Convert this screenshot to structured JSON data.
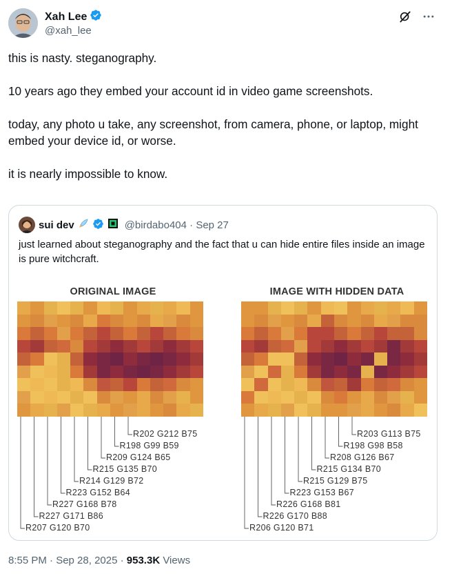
{
  "author": {
    "name": "Xah Lee",
    "handle": "@xah_lee"
  },
  "tweet": {
    "paragraphs": [
      "this is nasty. steganography.",
      "10 years ago they embed your account id in video game screenshots.",
      "today, any photo u take, any screenshot, from camera, phone, or laptop, might embed your device id, or worse.",
      "it is nearly impossible to know."
    ]
  },
  "quote": {
    "name": "sui dev",
    "handle": "@birdabo404",
    "date": "Sep 27",
    "text": "just learned about steganography and the fact that u can hide entire files inside an image is pure witchcraft.",
    "image": {
      "left_title": "ORIGINAL IMAGE",
      "right_title": "IMAGE WITH HIDDEN DATA",
      "left_values": [
        "R202 G212 B75",
        "R198 G99 B59",
        "R209 G124 B65",
        "R215 G135 B70",
        "R214 G129 B72",
        "R223 G152 B64",
        "R227 G168 B78",
        "R227 G171 B86",
        "R207 G120 B70"
      ],
      "right_values": [
        "R203 G113 B75",
        "R198 G98 B58",
        "R208 G126 B67",
        "R215 G134 B70",
        "R215 G129 B75",
        "R223 G153 B67",
        "R226 G168 B81",
        "R226 G170 B88",
        "R206 G120 B71"
      ]
    }
  },
  "footer": {
    "time": "8:55 PM · Sep 28, 2025 · ",
    "views_count": "953.3K",
    "views_label": " Views"
  },
  "colors": {
    "text": "#0f1419",
    "secondary": "#536471",
    "verified": "#1d9bf0",
    "border": "#cfd9de"
  },
  "icons": [
    "verified-badge-icon",
    "grok-icon",
    "more-icon",
    "rocket-emoji-icon",
    "affiliate-badge-icon"
  ]
}
